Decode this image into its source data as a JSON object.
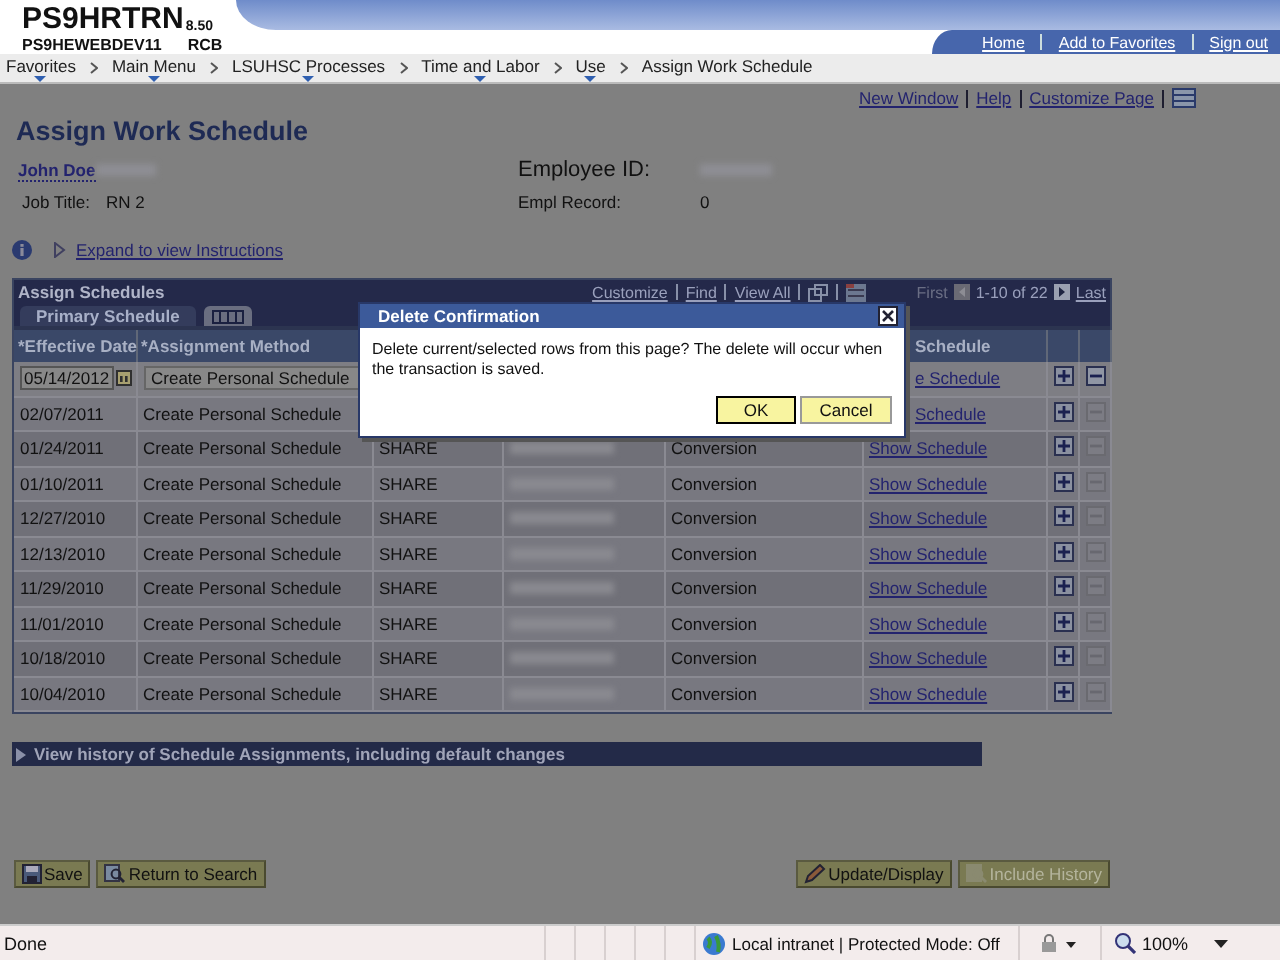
{
  "banner": {
    "system": "PS9HRTRN",
    "version": "8.50",
    "server": "PS9HEWEBDEV11",
    "user": "RCB",
    "links": [
      "Home",
      "Add to Favorites",
      "Sign out"
    ]
  },
  "breadcrumbs": [
    {
      "label": "Favorites",
      "menu": true
    },
    {
      "label": "Main Menu",
      "menu": true
    },
    {
      "label": "LSUHSC Processes",
      "menu": true
    },
    {
      "label": "Time and Labor",
      "menu": true
    },
    {
      "label": "Use",
      "menu": true
    },
    {
      "label": "Assign Work Schedule",
      "menu": false
    }
  ],
  "page_links": [
    "New Window",
    "Help",
    "Customize Page"
  ],
  "page_title": "Assign Work Schedule",
  "employee": {
    "name": "John Doe",
    "job_title_label": "Job Title:",
    "job_title": "RN 2",
    "id_label": "Employee ID:",
    "record_label": "Empl Record:",
    "record": "0"
  },
  "instructions_link": "Expand to view Instructions",
  "grid": {
    "title": "Assign Schedules",
    "tools": [
      "Customize",
      "Find",
      "View All"
    ],
    "first": "First",
    "range": "1-10 of 22",
    "last": "Last",
    "tabs": [
      {
        "kind": "text",
        "label": "Primary Schedule",
        "selected": true
      },
      {
        "kind": "icon",
        "selected": false
      }
    ],
    "columns": [
      {
        "label": "*Effective Date",
        "cut": false
      },
      {
        "label": "*Assignment Method",
        "cut": false
      },
      {},
      {},
      {},
      {
        "label": "Schedule",
        "cut": true
      }
    ],
    "rows": [
      {
        "kind": "edit",
        "date": "05/14/2012",
        "method": "Create Personal Schedule",
        "schedule": "e Schedule",
        "schedule_cut": true,
        "delete_disabled": false
      },
      {
        "kind": "display",
        "date": "02/07/2011",
        "method": "Create Personal Schedule",
        "schedule": "Schedule",
        "schedule_cut": true,
        "delete_disabled": true
      },
      {
        "kind": "display",
        "date": "01/24/2011",
        "method": "Create Personal Schedule",
        "group": "SHARE",
        "redacted": true,
        "source": "Conversion",
        "schedule": "Show Schedule",
        "delete_disabled": true
      },
      {
        "kind": "display",
        "date": "01/10/2011",
        "method": "Create Personal Schedule",
        "group": "SHARE",
        "redacted": true,
        "source": "Conversion",
        "schedule": "Show Schedule",
        "delete_disabled": true
      },
      {
        "kind": "display",
        "date": "12/27/2010",
        "method": "Create Personal Schedule",
        "group": "SHARE",
        "redacted": true,
        "source": "Conversion",
        "schedule": "Show Schedule",
        "delete_disabled": true
      },
      {
        "kind": "display",
        "date": "12/13/2010",
        "method": "Create Personal Schedule",
        "group": "SHARE",
        "redacted": true,
        "source": "Conversion",
        "schedule": "Show Schedule",
        "delete_disabled": true
      },
      {
        "kind": "display",
        "date": "11/29/2010",
        "method": "Create Personal Schedule",
        "group": "SHARE",
        "redacted": true,
        "source": "Conversion",
        "schedule": "Show Schedule",
        "delete_disabled": true
      },
      {
        "kind": "display",
        "date": "11/01/2010",
        "method": "Create Personal Schedule",
        "group": "SHARE",
        "redacted": true,
        "source": "Conversion",
        "schedule": "Show Schedule",
        "delete_disabled": true
      },
      {
        "kind": "display",
        "date": "10/18/2010",
        "method": "Create Personal Schedule",
        "group": "SHARE",
        "redacted": true,
        "source": "Conversion",
        "schedule": "Show Schedule",
        "delete_disabled": true
      },
      {
        "kind": "display",
        "date": "10/04/2010",
        "method": "Create Personal Schedule",
        "group": "SHARE",
        "redacted": true,
        "source": "Conversion",
        "schedule": "Show Schedule",
        "delete_disabled": true
      }
    ]
  },
  "dialog": {
    "title": "Delete Confirmation",
    "message": "Delete current/selected rows from this page? The delete will occur when the transaction is saved.",
    "buttons": [
      "OK",
      "Cancel"
    ]
  },
  "history_bar": "View history of Schedule Assignments, including default changes",
  "buttons": [
    {
      "label": "Save",
      "disabled": false
    },
    {
      "label": "Return to Search",
      "disabled": false
    },
    {
      "label": "Update/Display",
      "disabled": false
    },
    {
      "label": "Include History",
      "disabled": true
    }
  ],
  "status_bar": {
    "text": "Done",
    "zone": "Local intranet | Protected Mode: Off",
    "zoom": "100%"
  }
}
